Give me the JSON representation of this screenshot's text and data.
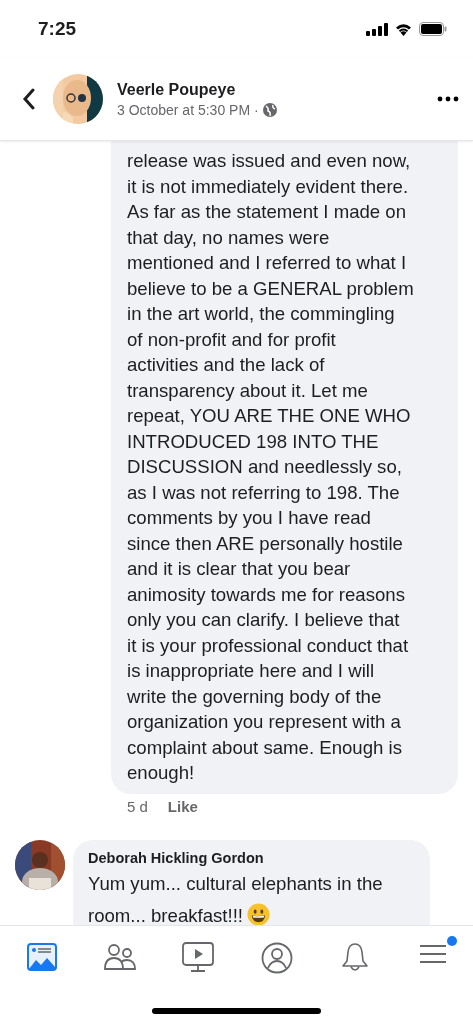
{
  "status_bar": {
    "time": "7:25"
  },
  "header": {
    "author": "Veerle Poupeye",
    "meta": "3 October at 5:30 PM ·"
  },
  "comments": [
    {
      "kind": "reply",
      "lines": [
        "release was issued and even now,",
        "it is not immediately evident there.",
        "As far as the statement I made on",
        "that day, no names were",
        "mentioned and I referred to what I",
        "believe to be a GENERAL problem",
        "in the art world, the commingling",
        "of non-profit and for profit",
        "activities and the lack of",
        "transparency about it. Let me",
        "repeat, YOU ARE THE ONE WHO",
        "INTRODUCED 198 INTO THE",
        "DISCUSSION and needlessly so,",
        "as I was not referring to 198. The",
        "comments by you I have read",
        "since then ARE personally hostile",
        "and it is clear that you bear",
        "animosity towards me for reasons",
        "only you can clarify. I believe that",
        "it is your professional conduct that",
        "is inappropriate here and I will",
        "write the governing body of the",
        "organization you represent with a",
        "complaint about same. Enough is",
        "enough!"
      ],
      "age": "5 d",
      "like": "Like"
    },
    {
      "kind": "comment",
      "author": "Deborah Hickling Gordon",
      "lines": [
        "Yum yum... cultural elephants in the",
        "room... breakfast!!!"
      ]
    }
  ],
  "tab_bar": [
    {
      "kind": "news-feed",
      "selected": true,
      "badge": false
    },
    {
      "kind": "friends",
      "selected": false,
      "badge": false
    },
    {
      "kind": "watch",
      "selected": false,
      "badge": false
    },
    {
      "kind": "profile",
      "selected": false,
      "badge": false
    },
    {
      "kind": "notifications",
      "selected": false,
      "badge": false
    },
    {
      "kind": "menu",
      "selected": false,
      "badge": true
    }
  ]
}
